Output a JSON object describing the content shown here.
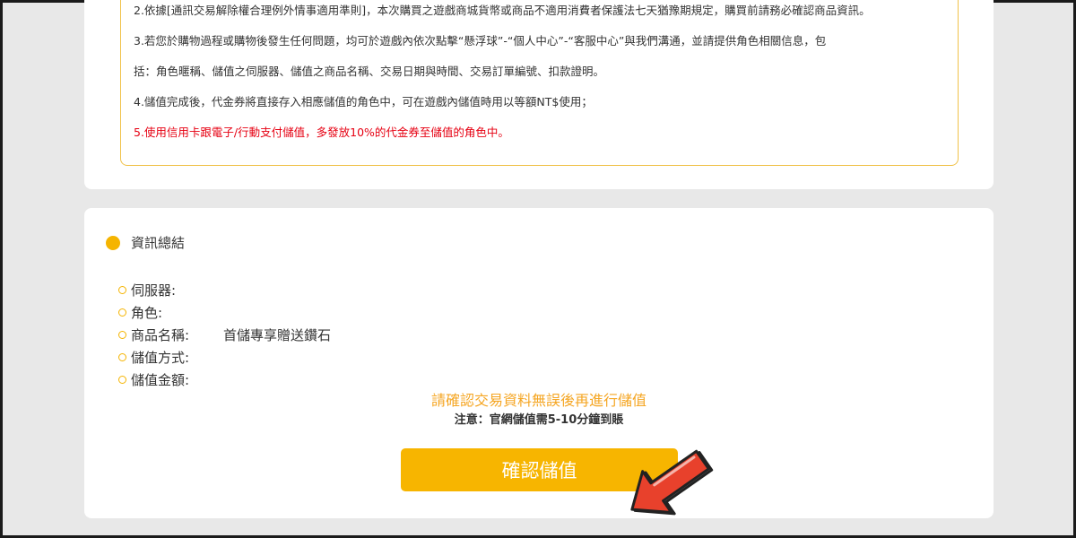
{
  "notice": {
    "lines": [
      "2.依據[通訊交易解除權合理例外情事適用準則]，本次購買之遊戲商城貨幣或商品不適用消費者保護法七天猶豫期規定，購買前請務必確認商品資訊。",
      "3.若您於購物過程或購物後發生任何問題，均可於遊戲內依次點擊“懸浮球”-“個人中心”-“客服中心”與我們溝通，並請提供角色相關信息，包",
      "括：角色暱稱、儲值之伺服器、儲值之商品名稱、交易日期與時間、交易訂單編號、扣款證明。",
      "4.儲值完成後，代金券將直接存入相應儲值的角色中，可在遊戲內儲值時用以等額NT$使用；",
      "5.使用信用卡跟電子/行動支付儲值，多發放10%的代金券至儲值的角色中。"
    ]
  },
  "summary": {
    "title": "資訊總結",
    "rows": [
      {
        "label": "伺服器:",
        "value": ""
      },
      {
        "label": "角色:",
        "value": ""
      },
      {
        "label": "商品名稱:",
        "value": "首儲專享贈送鑽石"
      },
      {
        "label": "儲值方式:",
        "value": ""
      },
      {
        "label": "儲值金額:",
        "value": ""
      }
    ],
    "confirm_tip": "請確認交易資料無誤後再進行儲值",
    "confirm_note": "注意：官網儲值需5-10分鐘到賬",
    "confirm_button": "確認儲值"
  },
  "colors": {
    "accent": "#f7b500",
    "warning_red": "#e60012",
    "tip_orange": "#f5a623",
    "arrow_red": "#e8412c"
  }
}
